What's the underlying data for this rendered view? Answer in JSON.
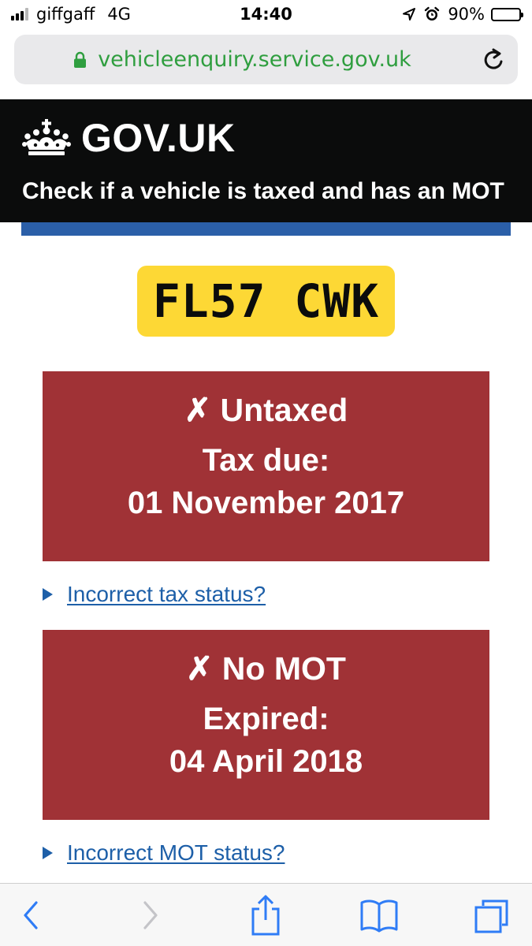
{
  "status_bar": {
    "carrier": "giffgaff",
    "network": "4G",
    "time": "14:40",
    "battery_percent": "90%",
    "battery_level": 0.9,
    "icons": [
      "signal-icon",
      "location-icon",
      "alarm-icon",
      "battery-icon"
    ]
  },
  "browser": {
    "url": "vehicleenquiry.service.gov.uk",
    "secure_color": "#2f9e3f",
    "icons": [
      "lock-icon",
      "reload-icon",
      "back-icon",
      "forward-icon",
      "share-icon",
      "bookmarks-icon",
      "tabs-icon"
    ]
  },
  "header": {
    "logotype": "GOV.UK",
    "service_name": "Check if a vehicle is taxed and has an MOT",
    "background_color": "#0b0c0c",
    "accent_bar_color": "#2b5fa8"
  },
  "vehicle": {
    "registration": "FL57 CWK",
    "plate_color": "#fdd835"
  },
  "tax_status": {
    "heading": "✗ Untaxed",
    "label": "Tax due:",
    "date": "01 November 2017",
    "panel_color": "#a03236",
    "details_link": "Incorrect tax status?"
  },
  "mot_status": {
    "heading": "✗ No MOT",
    "label": "Expired:",
    "date": "04 April 2018",
    "panel_color": "#a03236",
    "details_link": "Incorrect MOT status?"
  },
  "link_color": "#1d5fa8"
}
